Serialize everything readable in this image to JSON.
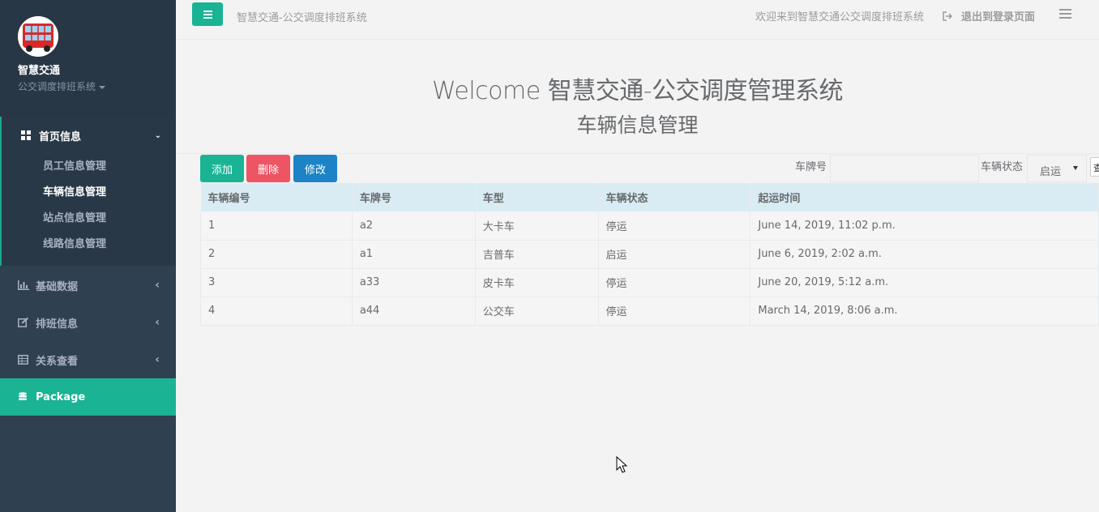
{
  "sidebar": {
    "profile": {
      "name": "智慧交通",
      "subtitle": "公交调度排班系统"
    },
    "home": {
      "label": "首页信息",
      "items": [
        {
          "label": "员工信息管理"
        },
        {
          "label": "车辆信息管理"
        },
        {
          "label": "站点信息管理"
        },
        {
          "label": "线路信息管理"
        }
      ]
    },
    "nav": [
      {
        "label": "基础数据"
      },
      {
        "label": "排班信息"
      },
      {
        "label": "关系查看"
      },
      {
        "label": "Package"
      }
    ]
  },
  "topbar": {
    "title": "智慧交通-公交调度排班系统",
    "welcome": "欢迎来到智慧交通公交调度排班系统",
    "logout": "退出到登录页面"
  },
  "header": {
    "welcome": "Welcome 智慧交通-公交调度管理系统",
    "subtitle": "车辆信息管理"
  },
  "toolbar": {
    "add": "添加",
    "delete": "删除",
    "edit": "修改",
    "plate_label": "车牌号",
    "plate_value": "",
    "status_label": "车辆状态",
    "status_value": "启运"
  },
  "table": {
    "columns": [
      "车辆编号",
      "车牌号",
      "车型",
      "车辆状态",
      "起运时间"
    ],
    "rows": [
      [
        "1",
        "a2",
        "大卡车",
        "停运",
        "June 14, 2019, 11:02 p.m."
      ],
      [
        "2",
        "a1",
        "吉普车",
        "启运",
        "June 6, 2019, 2:02 a.m."
      ],
      [
        "3",
        "a33",
        "皮卡车",
        "停运",
        "June 20, 2019, 5:12 a.m."
      ],
      [
        "4",
        "a44",
        "公交车",
        "停运",
        "March 14, 2019, 8:06 a.m."
      ]
    ]
  },
  "colors": {
    "accent": "#1ab394",
    "danger": "#ed5565",
    "primary": "#1c84c6",
    "sidebar": "#2f4050"
  }
}
